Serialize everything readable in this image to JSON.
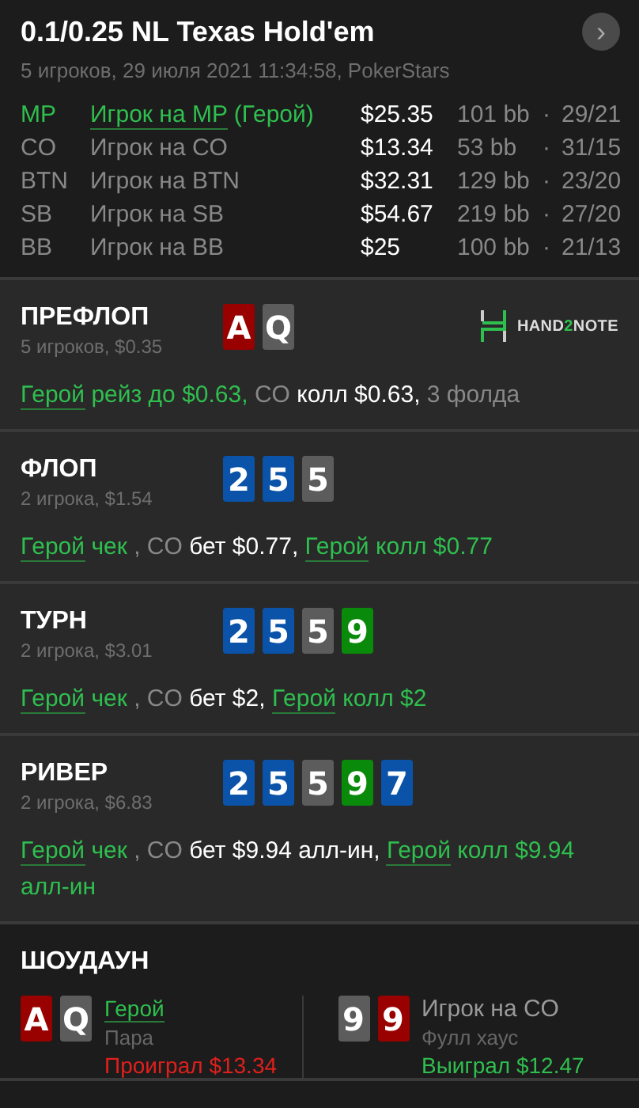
{
  "header": {
    "title": "0.1/0.25 NL Texas Hold'em",
    "subtitle": "5 игроков, 29 июля 2021 11:34:58, PokerStars",
    "next_button": "›"
  },
  "players": [
    {
      "position": "MP",
      "name": "Игрок на MP",
      "hero": true,
      "hero_tag": " (Герой)",
      "stack": "$25.35",
      "bb": "101 bb",
      "dot": "·",
      "stats": "29/21"
    },
    {
      "position": "CO",
      "name": "Игрок на CO",
      "hero": false,
      "stack": "$13.34",
      "bb": "53 bb",
      "dot": "·",
      "stats": "31/15"
    },
    {
      "position": "BTN",
      "name": "Игрок на BTN",
      "hero": false,
      "stack": "$32.31",
      "bb": "129 bb",
      "dot": "·",
      "stats": "23/20"
    },
    {
      "position": "SB",
      "name": "Игрок на SB",
      "hero": false,
      "stack": "$54.67",
      "bb": "219 bb",
      "dot": "·",
      "stats": "27/20"
    },
    {
      "position": "BB",
      "name": "Игрок на BB",
      "hero": false,
      "stack": "$25",
      "bb": "100 bb",
      "dot": "·",
      "stats": "21/13"
    }
  ],
  "streets": [
    {
      "title": "ПРЕФЛОП",
      "info": "5 игроков, $0.35",
      "cards": [
        {
          "rank": "A",
          "color": "#990000"
        },
        {
          "rank": "Q",
          "color": "#5c5c5c"
        }
      ],
      "logo": [
        {
          "text": "HAND",
          "accent": false
        },
        {
          "text": "2",
          "accent": true
        },
        {
          "text": "NOTE",
          "accent": false
        }
      ],
      "actions": [
        {
          "kind": "hero",
          "text": "Герой"
        },
        {
          "kind": "hero-action",
          "text": " рейз до $0.63,"
        },
        {
          "kind": "player",
          "text": " CO"
        },
        {
          "kind": "action",
          "text": " колл $0.63,"
        },
        {
          "kind": "player",
          "text": " 3 фолда"
        }
      ]
    },
    {
      "title": "ФЛОП",
      "info": "2 игрока, $1.54",
      "cards": [
        {
          "rank": "2",
          "color": "#0a53a8"
        },
        {
          "rank": "5",
          "color": "#0a53a8"
        },
        {
          "rank": "5",
          "color": "#5c5c5c"
        }
      ],
      "actions": [
        {
          "kind": "hero",
          "text": "Герой"
        },
        {
          "kind": "hero-action",
          "text": " чек "
        },
        {
          "kind": "player",
          "text": ", CO"
        },
        {
          "kind": "action",
          "text": " бет $0.77, "
        },
        {
          "kind": "hero",
          "text": "Герой"
        },
        {
          "kind": "hero-action",
          "text": " колл $0.77"
        }
      ]
    },
    {
      "title": "ТУРН",
      "info": "2 игрока, $3.01",
      "cards": [
        {
          "rank": "2",
          "color": "#0a53a8"
        },
        {
          "rank": "5",
          "color": "#0a53a8"
        },
        {
          "rank": "5",
          "color": "#5c5c5c"
        },
        {
          "rank": "9",
          "color": "#0a8a0a"
        }
      ],
      "actions": [
        {
          "kind": "hero",
          "text": "Герой"
        },
        {
          "kind": "hero-action",
          "text": " чек "
        },
        {
          "kind": "player",
          "text": ", CO"
        },
        {
          "kind": "action",
          "text": " бет $2, "
        },
        {
          "kind": "hero",
          "text": "Герой"
        },
        {
          "kind": "hero-action",
          "text": " колл $2"
        }
      ]
    },
    {
      "title": "РИВЕР",
      "info": "2 игрока, $6.83",
      "cards": [
        {
          "rank": "2",
          "color": "#0a53a8"
        },
        {
          "rank": "5",
          "color": "#0a53a8"
        },
        {
          "rank": "5",
          "color": "#5c5c5c"
        },
        {
          "rank": "9",
          "color": "#0a8a0a"
        },
        {
          "rank": "7",
          "color": "#0a53a8"
        }
      ],
      "actions": [
        {
          "kind": "hero",
          "text": "Герой"
        },
        {
          "kind": "hero-action",
          "text": " чек "
        },
        {
          "kind": "player",
          "text": ", CO"
        },
        {
          "kind": "action",
          "text": " бет $9.94 алл-ин, "
        },
        {
          "kind": "hero",
          "text": "Герой"
        },
        {
          "kind": "hero-action",
          "text": " колл $9.94 алл-ин"
        }
      ]
    }
  ],
  "showdown": {
    "title": "ШОУДАУН",
    "hands": [
      {
        "cards": [
          {
            "rank": "A",
            "color": "#990000"
          },
          {
            "rank": "Q",
            "color": "#5c5c5c"
          }
        ],
        "name": "Герой",
        "hero": true,
        "hand": "Пара",
        "result": "Проиграл $13.34",
        "won": false
      },
      {
        "cards": [
          {
            "rank": "9",
            "color": "#5c5c5c"
          },
          {
            "rank": "9",
            "color": "#990000"
          }
        ],
        "name": "Игрок на CO",
        "hero": false,
        "hand": "Фулл хаус",
        "result": "Выиграл $12.47",
        "won": true
      }
    ]
  }
}
